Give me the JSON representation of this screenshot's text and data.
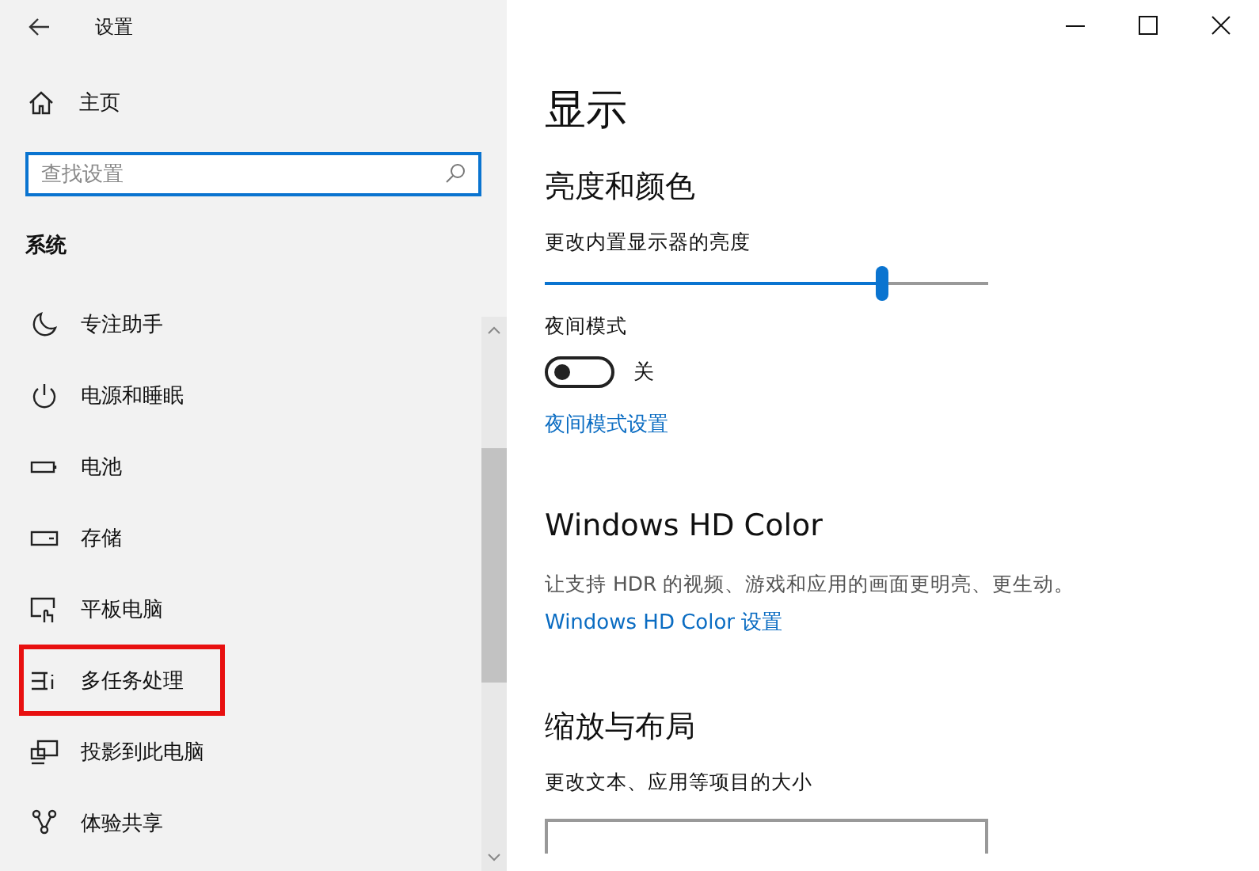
{
  "window": {
    "title": "设置"
  },
  "sidebar": {
    "home": "主页",
    "search": {
      "placeholder": "查找设置"
    },
    "section": "系统",
    "items": [
      {
        "label": "专注助手",
        "kind": "moon",
        "highlighted": false
      },
      {
        "label": "电源和睡眠",
        "kind": "power",
        "highlighted": false
      },
      {
        "label": "电池",
        "kind": "battery",
        "highlighted": false
      },
      {
        "label": "存储",
        "kind": "storage",
        "highlighted": false
      },
      {
        "label": "平板电脑",
        "kind": "tablet",
        "highlighted": false
      },
      {
        "label": "多任务处理",
        "kind": "multitask",
        "highlighted": true
      },
      {
        "label": "投影到此电脑",
        "kind": "project",
        "highlighted": false
      },
      {
        "label": "体验共享",
        "kind": "share",
        "highlighted": false
      }
    ]
  },
  "content": {
    "title": "显示",
    "brightness": {
      "heading": "亮度和颜色",
      "label": "更改内置显示器的亮度",
      "level": 0.76
    },
    "night": {
      "label": "夜间模式",
      "on": false,
      "state_text": "关",
      "link": "夜间模式设置"
    },
    "hdr": {
      "heading": "Windows HD Color",
      "description": "让支持 HDR 的视频、游戏和应用的画面更明亮、更生动。",
      "link": "Windows HD Color 设置"
    },
    "scale": {
      "heading": "缩放与布局",
      "label": "更改文本、应用等项目的大小"
    }
  }
}
